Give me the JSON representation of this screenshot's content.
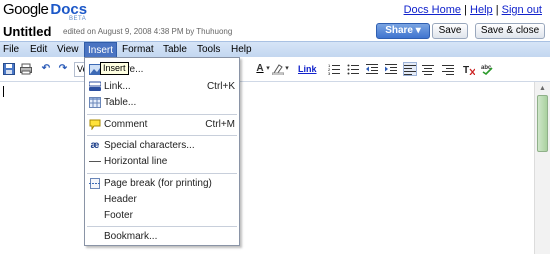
{
  "app": {
    "logo_google": "Google",
    "logo_docs": "Docs",
    "logo_beta": "BETA"
  },
  "header": {
    "links": [
      "Docs Home",
      "Help",
      "Sign out"
    ],
    "separator": "|",
    "title": "Untitled",
    "meta": "edited on August 9, 2008 4:38 PM by Thuhuong",
    "share_label": "Share",
    "save_label": "Save",
    "save_close_label": "Save & close"
  },
  "menubar": {
    "items": [
      "File",
      "Edit",
      "View",
      "Insert",
      "Format",
      "Table",
      "Tools",
      "Help"
    ],
    "active": "Insert"
  },
  "toolbar": {
    "link_label": "Link",
    "truncated_text": "Ve"
  },
  "insert_menu": {
    "items": [
      {
        "label": "Picture...",
        "icon": "picture-icon",
        "shortcut": ""
      },
      {
        "label": "Link...",
        "icon": "link-icon",
        "shortcut": "Ctrl+K"
      },
      {
        "label": "Table...",
        "icon": "table-icon",
        "shortcut": ""
      },
      {
        "label": "Comment",
        "icon": "comment-icon",
        "shortcut": "Ctrl+M"
      },
      {
        "label": "Special characters...",
        "icon": "special-characters-icon",
        "shortcut": ""
      },
      {
        "label": "Horizontal line",
        "icon": "horizontal-line-icon",
        "shortcut": ""
      },
      {
        "label": "Page break (for printing)",
        "icon": "page-break-icon",
        "shortcut": ""
      },
      {
        "label": "Header",
        "icon": "",
        "shortcut": ""
      },
      {
        "label": "Footer",
        "icon": "",
        "shortcut": ""
      },
      {
        "label": "Bookmark...",
        "icon": "",
        "shortcut": ""
      }
    ],
    "tooltip": "Insert"
  },
  "colors": {
    "menubar": "#c9dcf3",
    "active_menu": "#4a74c2",
    "link": "#1122cc",
    "share": "#3f74cf",
    "scroll_thumb": "#a9d19f"
  }
}
